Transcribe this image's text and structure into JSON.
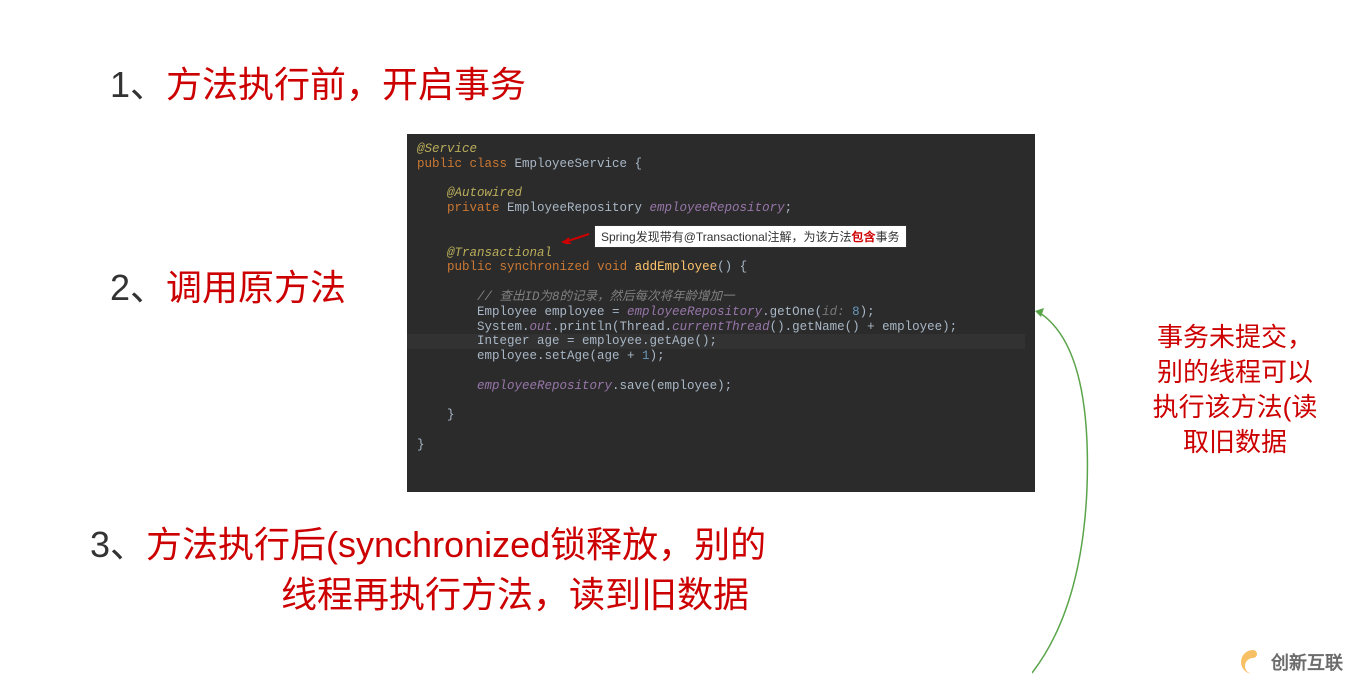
{
  "steps": {
    "one": {
      "number": "1、",
      "text": "方法执行前，开启事务"
    },
    "two": {
      "number": "2、",
      "text": "调用原方法"
    },
    "three": {
      "number": "3、",
      "text_line1": "方法执行后(synchronized锁释放，别的",
      "text_line2": "线程再执行方法，读到旧数据"
    }
  },
  "code": {
    "service_anno": "@Service",
    "public_kw": "public ",
    "class_kw": "class ",
    "class_name": "EmployeeService {",
    "autowired_anno": "    @Autowired",
    "private_kw": "    private ",
    "repo_type": "EmployeeRepository ",
    "repo_field": "employeeRepository",
    "semicolon": ";",
    "transactional_anno": "    @Transactional",
    "sync_kw": "synchronized ",
    "void_kw": "void ",
    "method_name": "addEmployee",
    "method_paren": "() {",
    "comment": "        // 查出ID为8的记录，然后每次将年龄增加一",
    "emp_decl": "        Employee employee = ",
    "repo_ref": "employeeRepository",
    "getone": ".getOne(",
    "id_hint": "id: ",
    "id_val": "8",
    "close_call": ");",
    "sout_prefix": "        System.",
    "out_field": "out",
    "println": ".println(Thread.",
    "currentthread": "currentThread",
    "getname": "().getName() + employee);",
    "int_decl": "        Integer age = employee.getAge();",
    "setage_prefix": "        employee.setAge(age + ",
    "one_val": "1",
    "setage_close": ");",
    "save_prefix": "        ",
    "save_call": ".save(employee);",
    "close_brace1": "    }",
    "close_brace2": "}"
  },
  "tooltip": {
    "prefix": "Spring发现带有@Transactional注解，为该方法",
    "red": "包含",
    "suffix": "事务"
  },
  "side_note": {
    "line1": "事务未提交，",
    "line2": "别的线程可以",
    "line3": "执行该方法(读",
    "line4": "取旧数据"
  },
  "watermark": {
    "text": "创新互联"
  }
}
